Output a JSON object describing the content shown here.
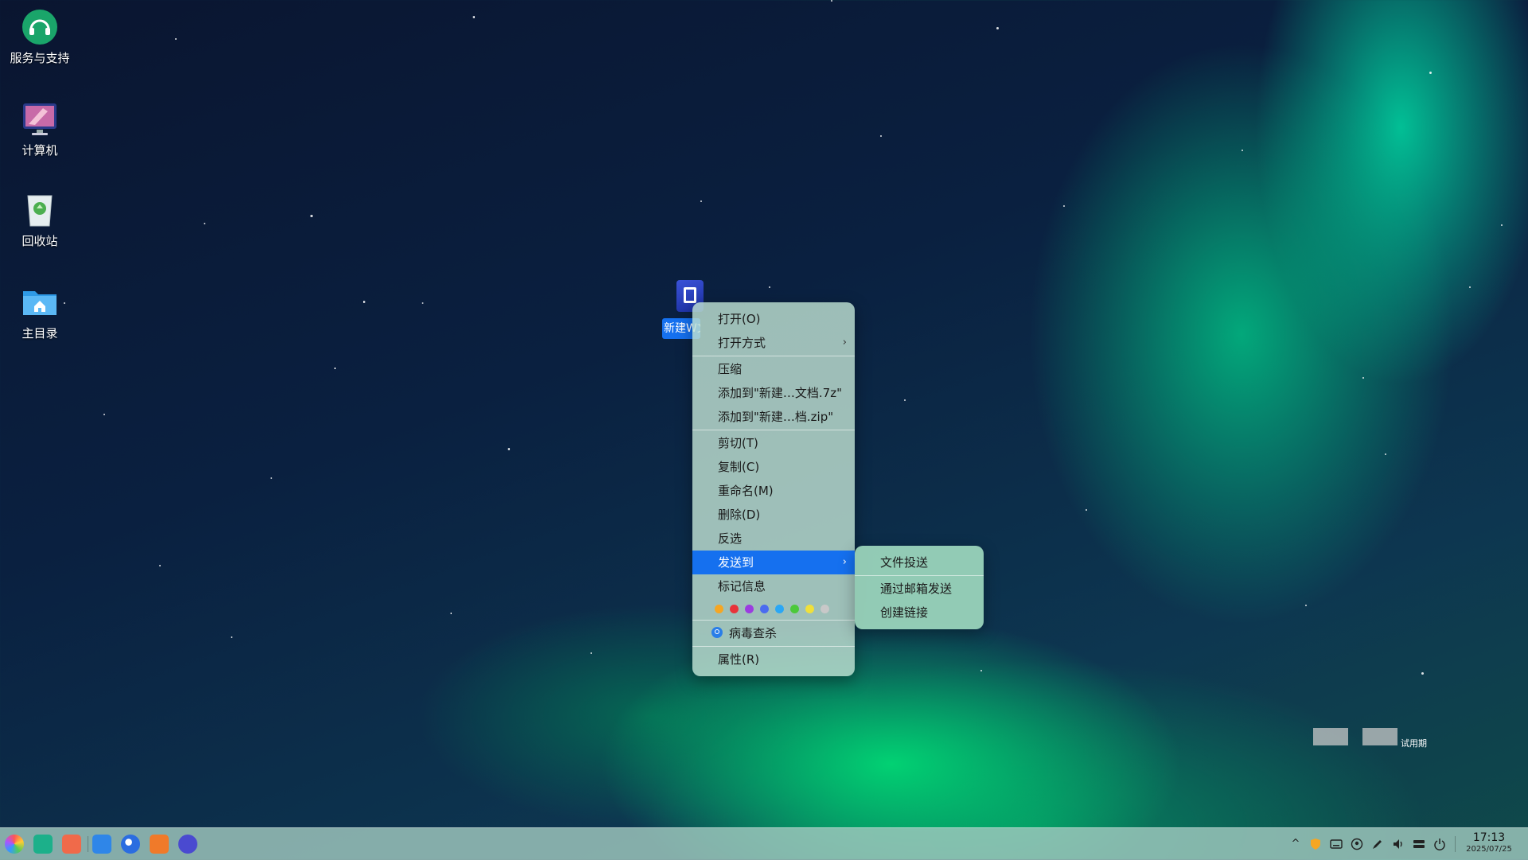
{
  "desktop": {
    "icons": [
      {
        "label": "服务与支持",
        "icon": "support-icon"
      },
      {
        "label": "计算机",
        "icon": "computer-icon"
      },
      {
        "label": "回收站",
        "icon": "trash-icon"
      },
      {
        "label": "主目录",
        "icon": "home-folder-icon"
      }
    ],
    "selected_file": {
      "name": "新建W文档",
      "icon": "word-document-icon"
    }
  },
  "context_menu": {
    "items": [
      {
        "label": "打开(O)"
      },
      {
        "label": "打开方式",
        "has_submenu": true
      },
      {
        "label": "压缩"
      },
      {
        "label": "添加到\"新建…文档.7z\""
      },
      {
        "label": "添加到\"新建…档.zip\""
      },
      {
        "label": "剪切(T)"
      },
      {
        "label": "复制(C)"
      },
      {
        "label": "重命名(M)"
      },
      {
        "label": "删除(D)"
      },
      {
        "label": "反选"
      },
      {
        "label": "发送到",
        "has_submenu": true,
        "active": true
      },
      {
        "label": "标记信息"
      },
      {
        "label": "病毒查杀",
        "icon": "antivirus-icon"
      },
      {
        "label": "属性(R)"
      }
    ],
    "tag_colors": [
      "#f5a623",
      "#e8333a",
      "#9b3ce0",
      "#4a6cf0",
      "#2aa7f5",
      "#4cc93a",
      "#f0e03a",
      "#c8c8c8"
    ],
    "arrow_glyph": "›"
  },
  "send_to_submenu": {
    "items": [
      {
        "label": "文件投送"
      },
      {
        "label": "通过邮箱发送"
      },
      {
        "label": "创建链接"
      }
    ]
  },
  "watermark": {
    "text": "试用期"
  },
  "taskbar": {
    "apps": [
      "launcher-icon",
      "multitasking-icon",
      "app-store-icon",
      "file-manager-icon",
      "browser-icon",
      "software-center-icon",
      "settings-icon"
    ],
    "tray": [
      "chevron-up-icon",
      "security-shield-icon",
      "keyboard-icon",
      "account-icon",
      "pen-icon",
      "volume-icon",
      "network-icon",
      "power-icon"
    ],
    "clock": {
      "time": "17:13",
      "date": "2025/07/25"
    },
    "tray_glyphs": {
      "chevron": "^"
    }
  }
}
